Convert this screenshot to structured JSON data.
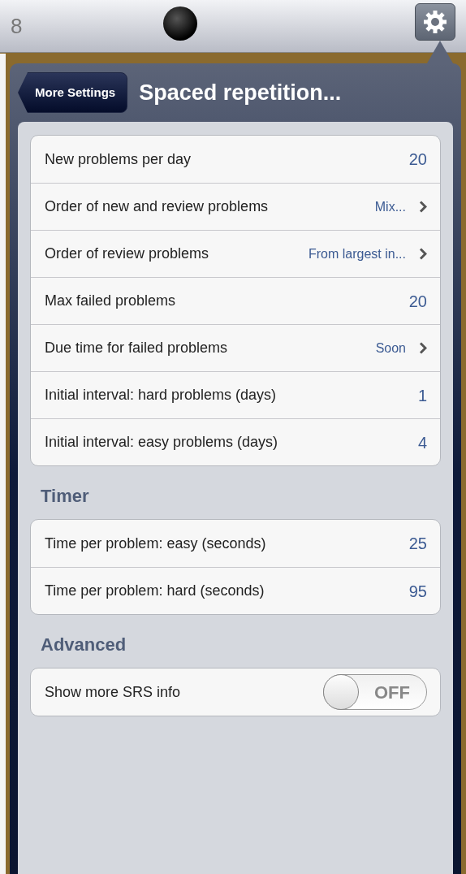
{
  "top_bar": {
    "clock_fragment": "8"
  },
  "popover": {
    "back_button": "More Settings",
    "title": "Spaced repetition..."
  },
  "sections": [
    {
      "rows": [
        {
          "kind": "value",
          "label": "New problems per day",
          "value": "20"
        },
        {
          "kind": "disclosure",
          "label": "Order of new and review problems",
          "value": "Mix..."
        },
        {
          "kind": "disclosure",
          "label": "Order of review problems",
          "value": "From largest in..."
        },
        {
          "kind": "value",
          "label": "Max failed problems",
          "value": "20"
        },
        {
          "kind": "disclosure",
          "label": "Due time for failed problems",
          "value": "Soon"
        },
        {
          "kind": "value",
          "label": "Initial interval: hard problems (days)",
          "value": "1"
        },
        {
          "kind": "value",
          "label": "Initial interval: easy problems (days)",
          "value": "4"
        }
      ]
    },
    {
      "header": "Timer",
      "rows": [
        {
          "kind": "value",
          "label": "Time per problem: easy (seconds)",
          "value": "25"
        },
        {
          "kind": "value",
          "label": "Time per problem: hard (seconds)",
          "value": "95"
        }
      ]
    },
    {
      "header": "Advanced",
      "rows": [
        {
          "kind": "toggle",
          "label": "Show more SRS info",
          "on": false,
          "value": "OFF"
        }
      ]
    }
  ]
}
